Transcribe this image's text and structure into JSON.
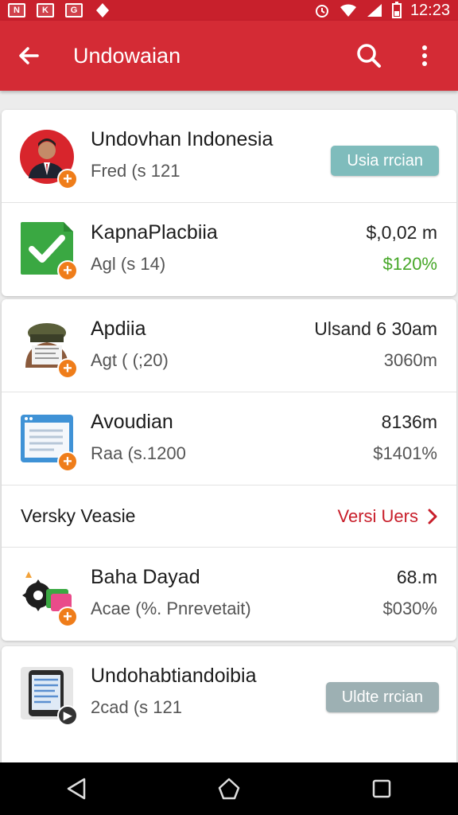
{
  "status_bar": {
    "left_icons": [
      "N",
      "K",
      "G",
      "location-icon"
    ],
    "time": "12:23"
  },
  "app_bar": {
    "title": "Undowaian",
    "back_icon": "arrow-left-icon",
    "search_icon": "search-icon",
    "menu_icon": "more-vert-icon"
  },
  "cards": [
    {
      "rows": [
        {
          "name": "Undovhan Indonesia",
          "sub": "Fred (s 121",
          "button": "Usia rrcian",
          "thumb": "avatar"
        },
        {
          "name": "KapnaPlacbiia",
          "sub": "Agl (s 14)",
          "value": "$,0,02 m",
          "change": "$120%",
          "thumb": "check-icon"
        }
      ]
    },
    {
      "rows": [
        {
          "name": "Apdiia",
          "sub": "Agt ( (;20)",
          "value": "Ulsand 6 30am",
          "change": "3060m",
          "thumb": "hat-person"
        },
        {
          "name": "Avoudian",
          "sub": "Raa (s.1200",
          "value": "8136m",
          "change": "$1401%",
          "thumb": "window-icon"
        }
      ],
      "section": {
        "title": "Versky Veasie",
        "link": "Versi Uers"
      },
      "rows2": [
        {
          "name": "Baha Dayad",
          "sub": "Acae (%. Pnrevetait)",
          "value": "68.m",
          "change": "$030%",
          "thumb": "gear-app-icon"
        }
      ]
    },
    {
      "rows": [
        {
          "name": "Undohabtiandoibia",
          "sub": "2cad (s 121",
          "button": "Uldte rrcian",
          "thumb": "phone-icon"
        }
      ]
    }
  ],
  "colors": {
    "primary": "#d42b35",
    "status": "#c8202c",
    "accent_orange": "#ef7d1a",
    "green": "#46a728",
    "teal_button": "#7fbcbc",
    "gray_button": "#9db0b3"
  }
}
